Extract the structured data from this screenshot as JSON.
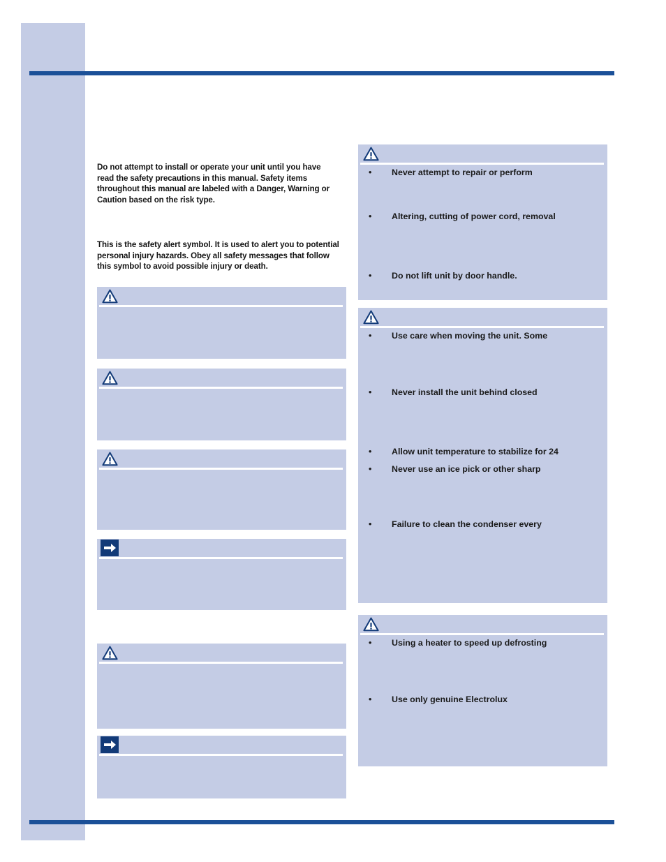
{
  "page": {
    "background_color": "#ffffff",
    "band_color": "#c4cce5",
    "rule_color": "#1b5098",
    "box_fill_color": "#c4cce5",
    "icon_navy": "#123a78"
  },
  "intro": {
    "paragraph_1": "Do not attempt to install or operate your unit until you have read the safety precautions in this manual. Safety items throughout this manual are labeled with a Danger, Warning or Caution based on the risk type.",
    "paragraph_2": " This is the safety alert symbol. It is used to alert you to potential personal injury hazards. Obey all safety messages that follow this symbol to avoid possible injury or death."
  },
  "left_column": {
    "boxes": [
      {
        "icon": "warning-triangle-icon",
        "items": []
      },
      {
        "icon": "warning-triangle-icon",
        "items": []
      },
      {
        "icon": "warning-triangle-icon",
        "items": []
      },
      {
        "icon": "arrow-right-icon",
        "items": []
      },
      {
        "icon": "warning-triangle-icon",
        "items": []
      },
      {
        "icon": "arrow-right-icon",
        "items": []
      }
    ]
  },
  "right_column": {
    "boxes": [
      {
        "icon": "warning-triangle-icon",
        "items": [
          "Never attempt to repair or perform",
          "Altering, cutting of power cord, removal",
          "Do not lift unit by door handle."
        ]
      },
      {
        "icon": "warning-triangle-icon",
        "items": [
          "Use care when moving the unit. Some",
          "Never install the unit behind closed",
          "Allow unit temperature to stabilize for 24",
          "Never use an ice pick or other sharp",
          "Failure to clean the condenser every"
        ]
      },
      {
        "icon": "warning-triangle-icon",
        "items": [
          "Using a heater to speed up defrosting",
          "Use only genuine Electrolux"
        ]
      }
    ]
  },
  "bullet_glyph": "•"
}
